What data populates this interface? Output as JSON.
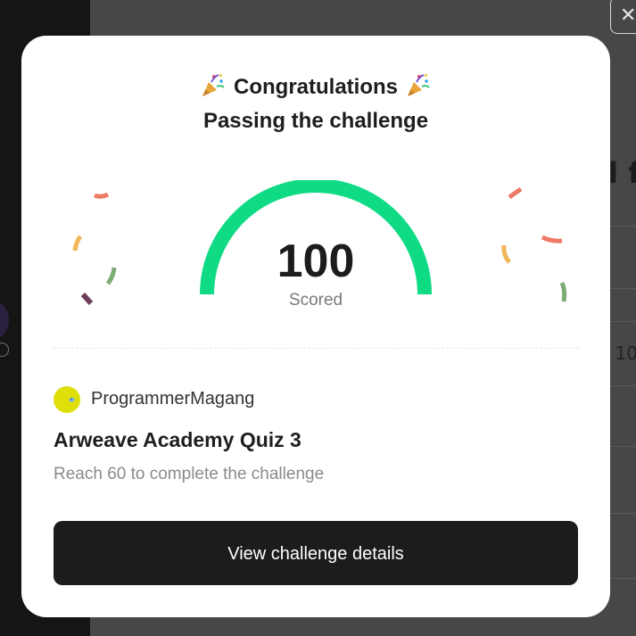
{
  "background": {
    "peek_heading": "l f",
    "peek_value": "- 10"
  },
  "modal": {
    "close_symbol": "✕",
    "headline": "Congratulations",
    "subtitle": "Passing the challenge",
    "score": {
      "value": "100",
      "label": "Scored",
      "progress_percent": 100
    },
    "owner": {
      "name": "ProgrammerMagang"
    },
    "challenge": {
      "title": "Arweave Academy Quiz 3",
      "requirement": "Reach 60 to complete the challenge"
    },
    "details_button_label": "View challenge details"
  },
  "colors": {
    "accent": "#10db85",
    "button": "#1c1c1c",
    "avatar": "#dfe00a"
  },
  "icons": [
    "party-popper-icon",
    "close-icon",
    "avatar-icon",
    "confetti"
  ]
}
